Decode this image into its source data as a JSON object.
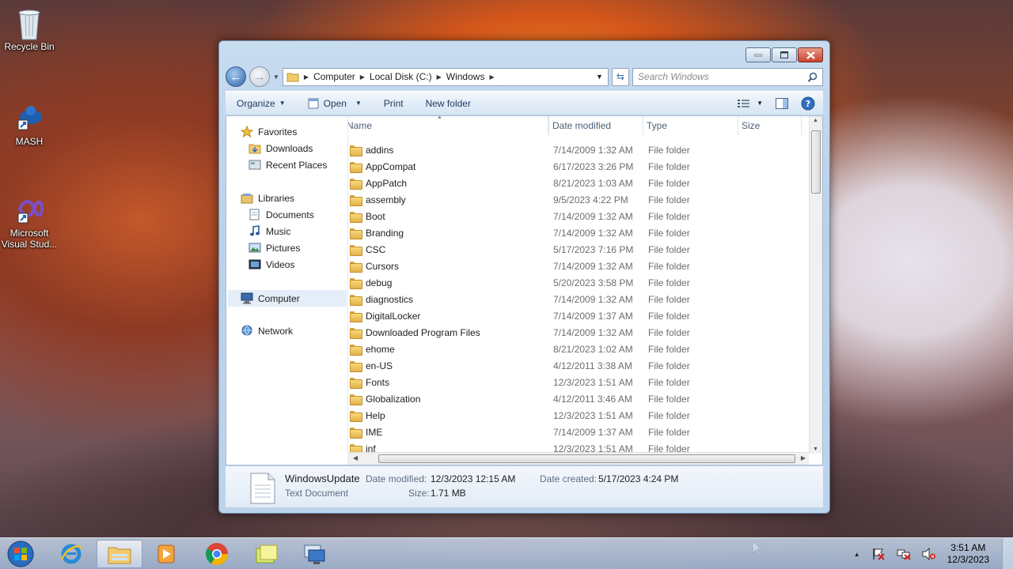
{
  "desktop": {
    "icons": [
      {
        "label": "Recycle Bin"
      },
      {
        "label": "MASH"
      },
      {
        "label": "Microsoft Visual Stud..."
      }
    ]
  },
  "window": {
    "breadcrumb": [
      "Computer",
      "Local Disk (C:)",
      "Windows"
    ],
    "search_placeholder": "Search Windows",
    "toolbar": {
      "organize": "Organize",
      "open": "Open",
      "print": "Print",
      "new_folder": "New folder"
    },
    "nav": {
      "favorites": "Favorites",
      "downloads": "Downloads",
      "recent_places": "Recent Places",
      "libraries": "Libraries",
      "documents": "Documents",
      "music": "Music",
      "pictures": "Pictures",
      "videos": "Videos",
      "computer": "Computer",
      "network": "Network"
    },
    "columns": {
      "name": "Name",
      "date": "Date modified",
      "type": "Type",
      "size": "Size"
    },
    "files": [
      {
        "name": "addins",
        "date": "7/14/2009 1:32 AM",
        "type": "File folder"
      },
      {
        "name": "AppCompat",
        "date": "6/17/2023 3:26 PM",
        "type": "File folder"
      },
      {
        "name": "AppPatch",
        "date": "8/21/2023 1:03 AM",
        "type": "File folder"
      },
      {
        "name": "assembly",
        "date": "9/5/2023 4:22 PM",
        "type": "File folder"
      },
      {
        "name": "Boot",
        "date": "7/14/2009 1:32 AM",
        "type": "File folder"
      },
      {
        "name": "Branding",
        "date": "7/14/2009 1:32 AM",
        "type": "File folder"
      },
      {
        "name": "CSC",
        "date": "5/17/2023 7:16 PM",
        "type": "File folder"
      },
      {
        "name": "Cursors",
        "date": "7/14/2009 1:32 AM",
        "type": "File folder"
      },
      {
        "name": "debug",
        "date": "5/20/2023 3:58 PM",
        "type": "File folder"
      },
      {
        "name": "diagnostics",
        "date": "7/14/2009 1:32 AM",
        "type": "File folder"
      },
      {
        "name": "DigitalLocker",
        "date": "7/14/2009 1:37 AM",
        "type": "File folder"
      },
      {
        "name": "Downloaded Program Files",
        "date": "7/14/2009 1:32 AM",
        "type": "File folder"
      },
      {
        "name": "ehome",
        "date": "8/21/2023 1:02 AM",
        "type": "File folder"
      },
      {
        "name": "en-US",
        "date": "4/12/2011 3:38 AM",
        "type": "File folder"
      },
      {
        "name": "Fonts",
        "date": "12/3/2023 1:51 AM",
        "type": "File folder"
      },
      {
        "name": "Globalization",
        "date": "4/12/2011 3:46 AM",
        "type": "File folder"
      },
      {
        "name": "Help",
        "date": "12/3/2023 1:51 AM",
        "type": "File folder"
      },
      {
        "name": "IME",
        "date": "7/14/2009 1:37 AM",
        "type": "File folder"
      },
      {
        "name": "inf",
        "date": "12/3/2023 1:51 AM",
        "type": "File folder"
      }
    ],
    "details": {
      "filename": "WindowsUpdate",
      "filetype": "Text Document",
      "modified_label": "Date modified:",
      "modified_value": "12/3/2023 12:15 AM",
      "created_label": "Date created:",
      "created_value": "5/17/2023 4:24 PM",
      "size_label": "Size:",
      "size_value": "1.71 MB"
    }
  },
  "taskbar": {
    "time": "3:51 AM",
    "date": "12/3/2023"
  }
}
